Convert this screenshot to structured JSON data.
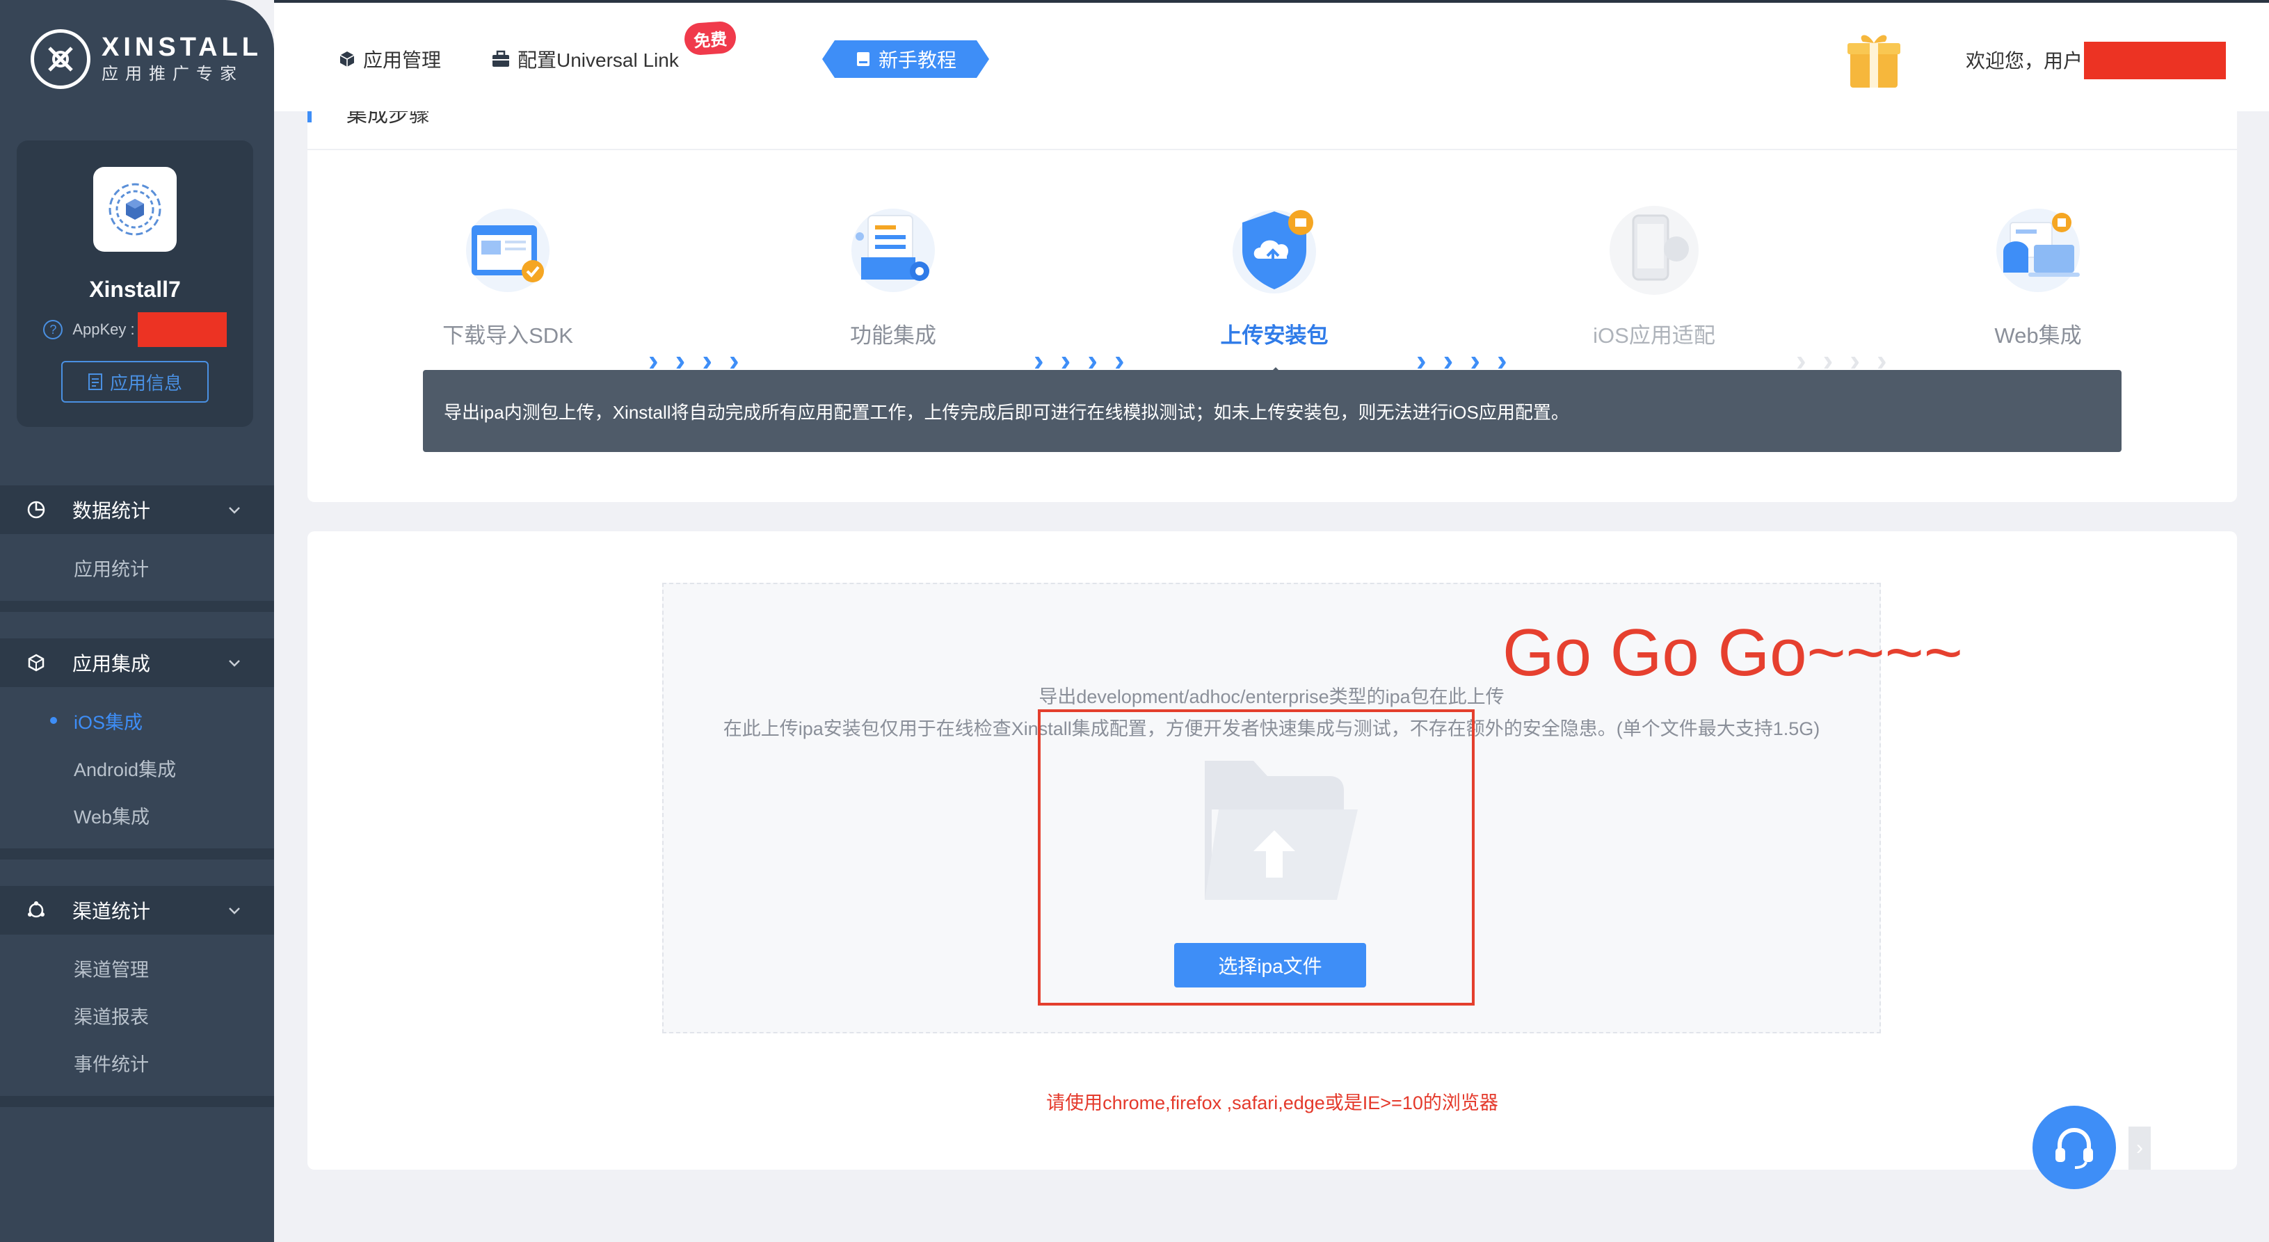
{
  "brand": {
    "name": "XINSTALL",
    "subtitle": "应用推广专家"
  },
  "app": {
    "name": "Xinstall7",
    "appkey_label": "AppKey :",
    "info_button": "应用信息"
  },
  "sidebar": {
    "groups": [
      {
        "label": "数据统计",
        "icon": "pie-chart-icon",
        "items": [
          {
            "label": "应用统计",
            "active": false
          }
        ]
      },
      {
        "label": "应用集成",
        "icon": "cube-icon",
        "items": [
          {
            "label": "iOS集成",
            "active": true
          },
          {
            "label": "Android集成",
            "active": false
          },
          {
            "label": "Web集成",
            "active": false
          }
        ]
      },
      {
        "label": "渠道统计",
        "icon": "channel-icon",
        "items": [
          {
            "label": "渠道管理",
            "active": false
          },
          {
            "label": "渠道报表",
            "active": false
          },
          {
            "label": "事件统计",
            "active": false
          }
        ]
      }
    ]
  },
  "header": {
    "nav": [
      {
        "label": "应用管理",
        "icon": "cube-icon"
      },
      {
        "label": "配置Universal Link",
        "icon": "briefcase-icon"
      }
    ],
    "free_badge": "免费",
    "tutorial": "新手教程",
    "welcome": "欢迎您，用户"
  },
  "steps": {
    "title": "集成步骤",
    "items": [
      {
        "label": "下载导入SDK",
        "icon": "sdk-download-icon",
        "state": "normal"
      },
      {
        "label": "功能集成",
        "icon": "feature-integration-icon",
        "state": "normal"
      },
      {
        "label": "上传安装包",
        "icon": "upload-package-icon",
        "state": "active"
      },
      {
        "label": "iOS应用适配",
        "icon": "ios-adapt-icon",
        "state": "disabled"
      },
      {
        "label": "Web集成",
        "icon": "web-integration-icon",
        "state": "normal"
      }
    ],
    "tip": "导出ipa内测包上传，Xinstall将自动完成所有应用配置工作，上传完成后即可进行在线模拟测试；如未上传安装包，则无法进行iOS应用配置。"
  },
  "upload": {
    "line1": "导出development/adhoc/enterprise类型的ipa包在此上传",
    "line2": "在此上传ipa安装包仅用于在线检查Xinstall集成配置，方便开发者快速集成与测试，不存在额外的安全隐患。(单个文件最大支持1.5G)",
    "button": "选择ipa文件",
    "annotation": "Go Go Go~~~~",
    "browser_note": "请使用chrome,firefox ,safari,edge或是IE>=10的浏览器"
  },
  "colors": {
    "accent": "#3e8ef7",
    "sidebar": "#374556",
    "redact": "#ec3323",
    "annotation": "#e6402f"
  }
}
